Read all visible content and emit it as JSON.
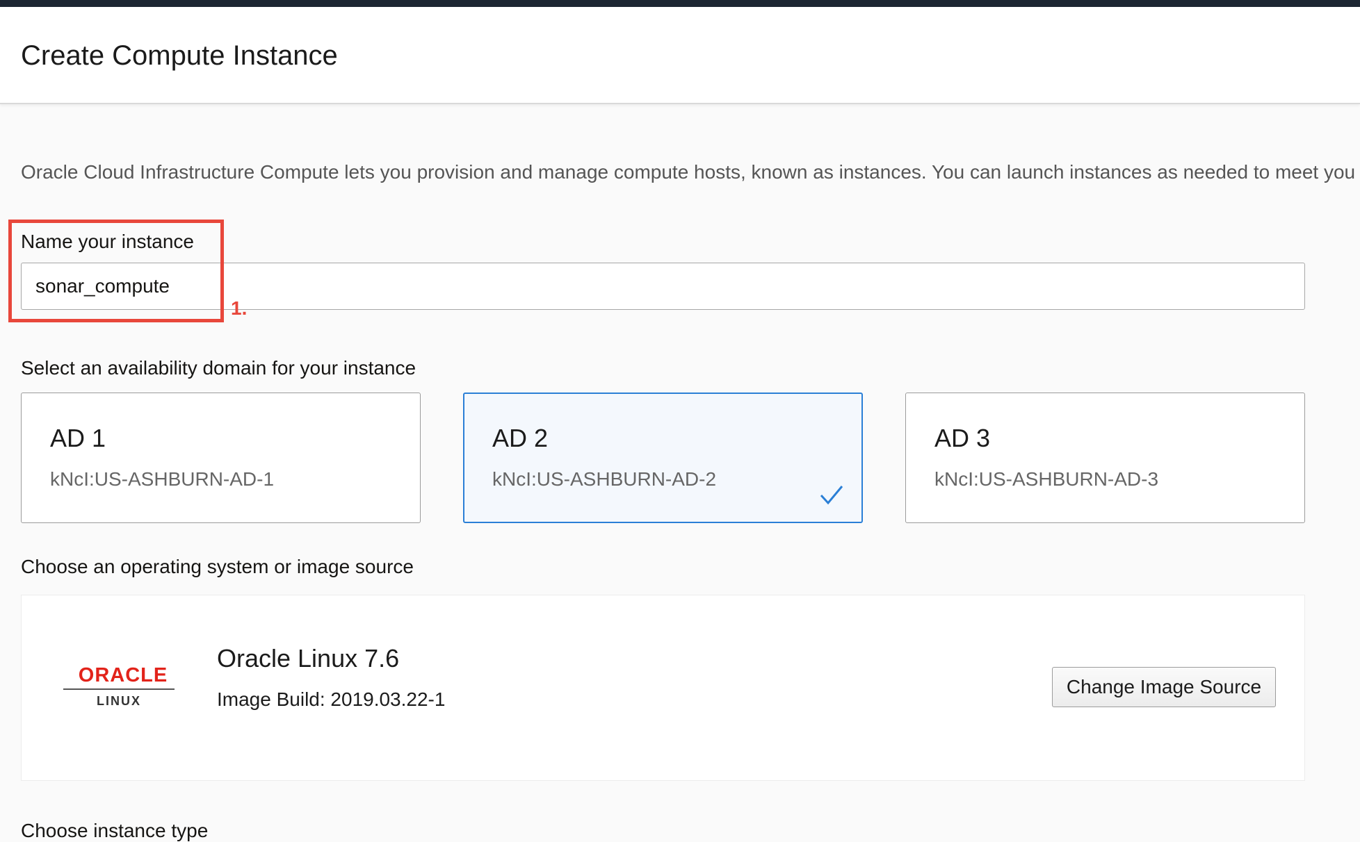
{
  "header": {
    "title": "Create Compute Instance"
  },
  "intro_text": "Oracle Cloud Infrastructure Compute lets you provision and manage compute hosts, known as instances. You can launch instances as needed to meet you",
  "name_section": {
    "label": "Name your instance",
    "value": "sonar_compute",
    "annotation": "1.",
    "annotation_color": "#e8473b"
  },
  "availability_section": {
    "label": "Select an availability domain for your instance",
    "domains": [
      {
        "title": "AD 1",
        "subtitle": "kNcI:US-ASHBURN-AD-1",
        "selected": false
      },
      {
        "title": "AD 2",
        "subtitle": "kNcI:US-ASHBURN-AD-2",
        "selected": true
      },
      {
        "title": "AD 3",
        "subtitle": "kNcI:US-ASHBURN-AD-3",
        "selected": false
      }
    ],
    "selected_color": "#2a7fd6"
  },
  "image_section": {
    "label": "Choose an operating system or image source",
    "logo": {
      "word": "ORACLE",
      "sub": "LINUX",
      "icon": "oracle-linux-logo"
    },
    "os_name": "Oracle Linux 7.6",
    "build": "Image Build: 2019.03.22-1",
    "change_button": "Change Image Source"
  },
  "next_section_label": "Choose instance type"
}
